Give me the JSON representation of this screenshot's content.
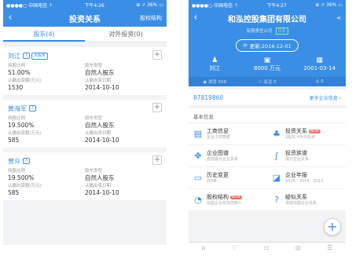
{
  "left": {
    "status": {
      "carrier": "●●●●○ 中国电信 ⇡",
      "time": "下午4:26",
      "battery": "⊕ ↗ 36% ▭"
    },
    "nav": {
      "back": "‹",
      "title": "投资关系",
      "action": "股权结构"
    },
    "tabs": [
      {
        "label": "股东(4)"
      },
      {
        "label": "对外投资(0)"
      }
    ],
    "cards": [
      {
        "name": "刘江",
        "badge": "大股东",
        "fields": [
          {
            "label": "持股比例",
            "value": "51.00%"
          },
          {
            "label": "股东类型",
            "value": "自然人股东"
          },
          {
            "label": "认缴出资额(万元)",
            "value": "1530"
          },
          {
            "label": "认缴出资日期",
            "value": "2014-10-10"
          }
        ]
      },
      {
        "name": "黄海军",
        "badge": "",
        "fields": [
          {
            "label": "持股比例",
            "value": "19.500%"
          },
          {
            "label": "股东类型",
            "value": "自然人股东"
          },
          {
            "label": "认缴出资额(万元)",
            "value": "585"
          },
          {
            "label": "认缴出资日期",
            "value": "2014-10-10"
          }
        ]
      },
      {
        "name": "曾众",
        "badge": "",
        "fields": [
          {
            "label": "持股比例",
            "value": "19.500%"
          },
          {
            "label": "股东类型",
            "value": "自然人股东"
          },
          {
            "label": "认缴出资额(万元)",
            "value": "585"
          },
          {
            "label": "认缴出资日期",
            "value": "2014-10-10"
          }
        ]
      }
    ]
  },
  "right": {
    "status": {
      "carrier": "●●●●○ 中国电信 ⇡",
      "time": "下午4:27",
      "battery": "⊕ ↗ 36% ▭"
    },
    "nav": {
      "back": "‹",
      "title": "和泓控股集团有限公司",
      "share": "⋖"
    },
    "company_type": "有限责任公司",
    "status_tag": "在业",
    "update_label": "更新:2016-12-01",
    "stats": [
      {
        "icon": "person-icon",
        "glyph": "♟",
        "value": "刘江"
      },
      {
        "icon": "money-icon",
        "glyph": "▣",
        "value": "8000 万元"
      },
      {
        "icon": "calendar-icon",
        "glyph": "▦",
        "value": "2001-03-14"
      }
    ],
    "metrics": [
      "◉ 浏览 558",
      "♡ 关注 0",
      "◎ 0"
    ],
    "phone": "87819860",
    "more": "更多企业信息 ›",
    "section": "基本信息",
    "items": [
      {
        "icon": "business-info-icon",
        "glyph": "▤",
        "title": "工商信息",
        "desc": "企业工商数据",
        "new": ""
      },
      {
        "icon": "investment-icon",
        "glyph": "♣",
        "title": "投资关系",
        "desc": "2股东,4对外投资",
        "new": "NEW"
      },
      {
        "icon": "graph-icon",
        "glyph": "✥",
        "title": "企业图谱",
        "desc": "直观展示企业关系",
        "new": ""
      },
      {
        "icon": "pedigree-icon",
        "glyph": "ʃ",
        "title": "投资族谱",
        "desc": "展示企业关系",
        "new": ""
      },
      {
        "icon": "history-icon",
        "glyph": "▭",
        "title": "历史变更",
        "desc": "共0条",
        "new": ""
      },
      {
        "icon": "annual-report-icon",
        "glyph": "◪",
        "title": "企业年报",
        "desc": "2016、2014、2013",
        "new": ""
      },
      {
        "icon": "equity-icon",
        "glyph": "◔",
        "title": "股权结构",
        "desc": "挖掘企业实际控制人",
        "new": "NEW"
      },
      {
        "icon": "control-icon",
        "glyph": "?",
        "title": "疑似关系",
        "desc": "深度挖掘企业关系",
        "new": ""
      }
    ],
    "fab": "+",
    "tabbar": [
      "⌂",
      "♡",
      "▭",
      "◎",
      "☰"
    ]
  }
}
